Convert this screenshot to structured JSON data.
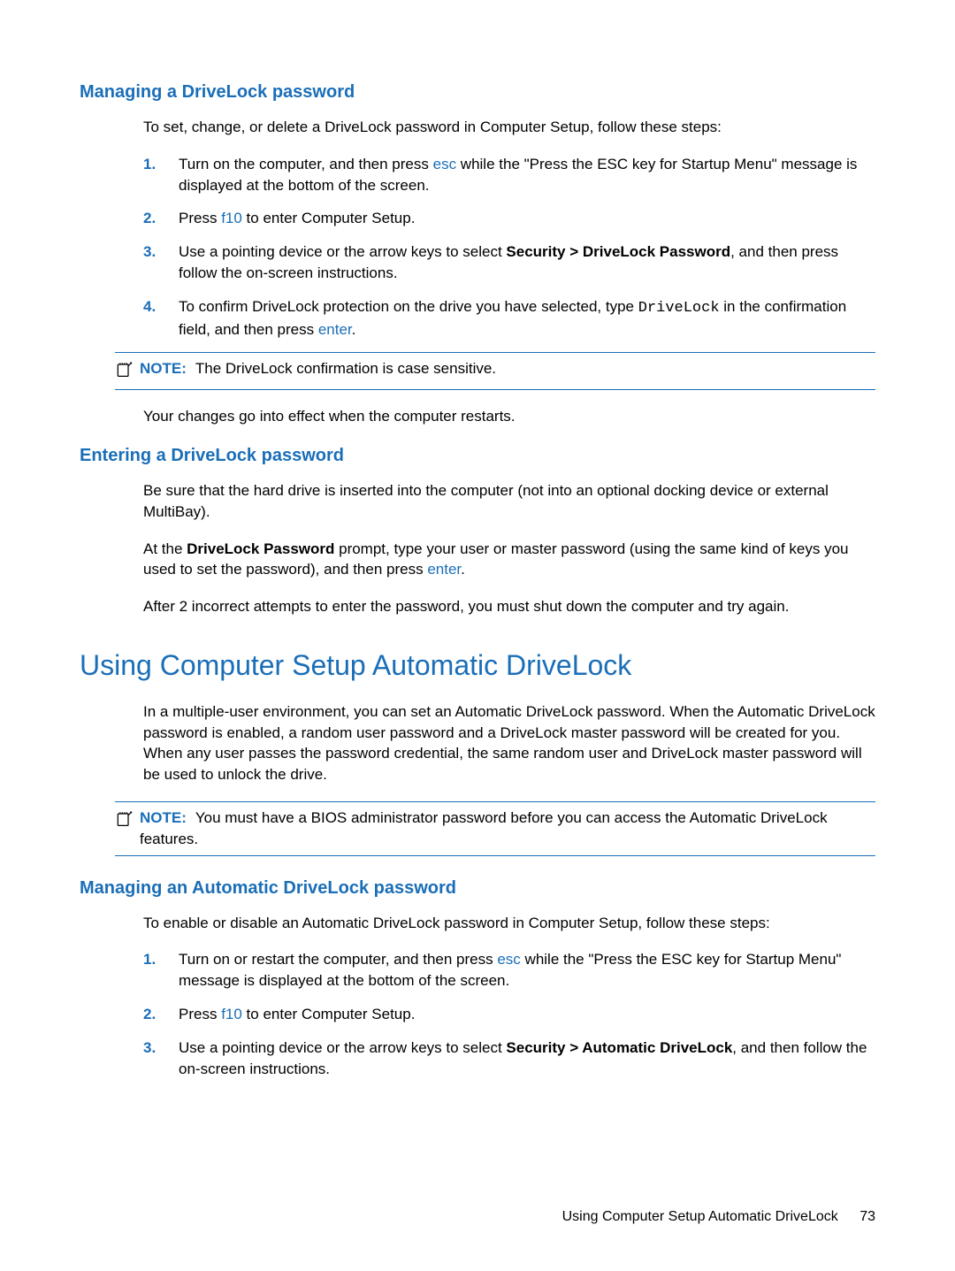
{
  "sections": {
    "managing_dl": {
      "heading": "Managing a DriveLock password",
      "intro": "To set, change, or delete a DriveLock password in Computer Setup, follow these steps:",
      "steps": {
        "s1a": "Turn on the computer, and then press ",
        "s1_key": "esc",
        "s1b": " while the \"Press the ESC key for Startup Menu\" message is displayed at the bottom of the screen.",
        "s2a": "Press ",
        "s2_key": "f10",
        "s2b": " to enter Computer Setup.",
        "s3a": "Use a pointing device or the arrow keys to select ",
        "s3_bold": "Security > DriveLock Password",
        "s3b": ", and then press follow the on-screen instructions.",
        "s4a": "To confirm DriveLock protection on the drive you have selected, type ",
        "s4_mono": "DriveLock",
        "s4b": " in the confirmation field, and then press ",
        "s4_key": "enter",
        "s4c": "."
      },
      "note_label": "NOTE:",
      "note_text": "The DriveLock confirmation is case sensitive.",
      "post": "Your changes go into effect when the computer restarts."
    },
    "entering_dl": {
      "heading": "Entering a DriveLock password",
      "p1": "Be sure that the hard drive is inserted into the computer (not into an optional docking device or external MultiBay).",
      "p2a": "At the ",
      "p2_bold": "DriveLock Password",
      "p2b": " prompt, type your user or master password (using the same kind of keys you used to set the password), and then press ",
      "p2_key": "enter",
      "p2c": ".",
      "p3": "After 2 incorrect attempts to enter the password, you must shut down the computer and try again."
    },
    "auto_dl": {
      "heading": "Using Computer Setup Automatic DriveLock",
      "p1": "In a multiple-user environment, you can set an Automatic DriveLock password. When the Automatic DriveLock password is enabled, a random user password and a DriveLock master password will be created for you. When any user passes the password credential, the same random user and DriveLock master password will be used to unlock the drive.",
      "note_label": "NOTE:",
      "note_text": "You must have a BIOS administrator password before you can access the Automatic DriveLock features."
    },
    "managing_auto": {
      "heading": "Managing an Automatic DriveLock password",
      "intro": "To enable or disable an Automatic DriveLock password in Computer Setup, follow these steps:",
      "steps": {
        "s1a": "Turn on or restart the computer, and then press ",
        "s1_key": "esc",
        "s1b": " while the \"Press the ESC key for Startup Menu\" message is displayed at the bottom of the screen.",
        "s2a": "Press ",
        "s2_key": "f10",
        "s2b": " to enter Computer Setup.",
        "s3a": "Use a pointing device or the arrow keys to select ",
        "s3_bold": "Security > Automatic DriveLock",
        "s3b": ", and then follow the on-screen instructions."
      }
    }
  },
  "footer": {
    "section_title": "Using Computer Setup Automatic DriveLock",
    "page_number": "73"
  },
  "list_numbers": {
    "n1": "1.",
    "n2": "2.",
    "n3": "3.",
    "n4": "4."
  }
}
